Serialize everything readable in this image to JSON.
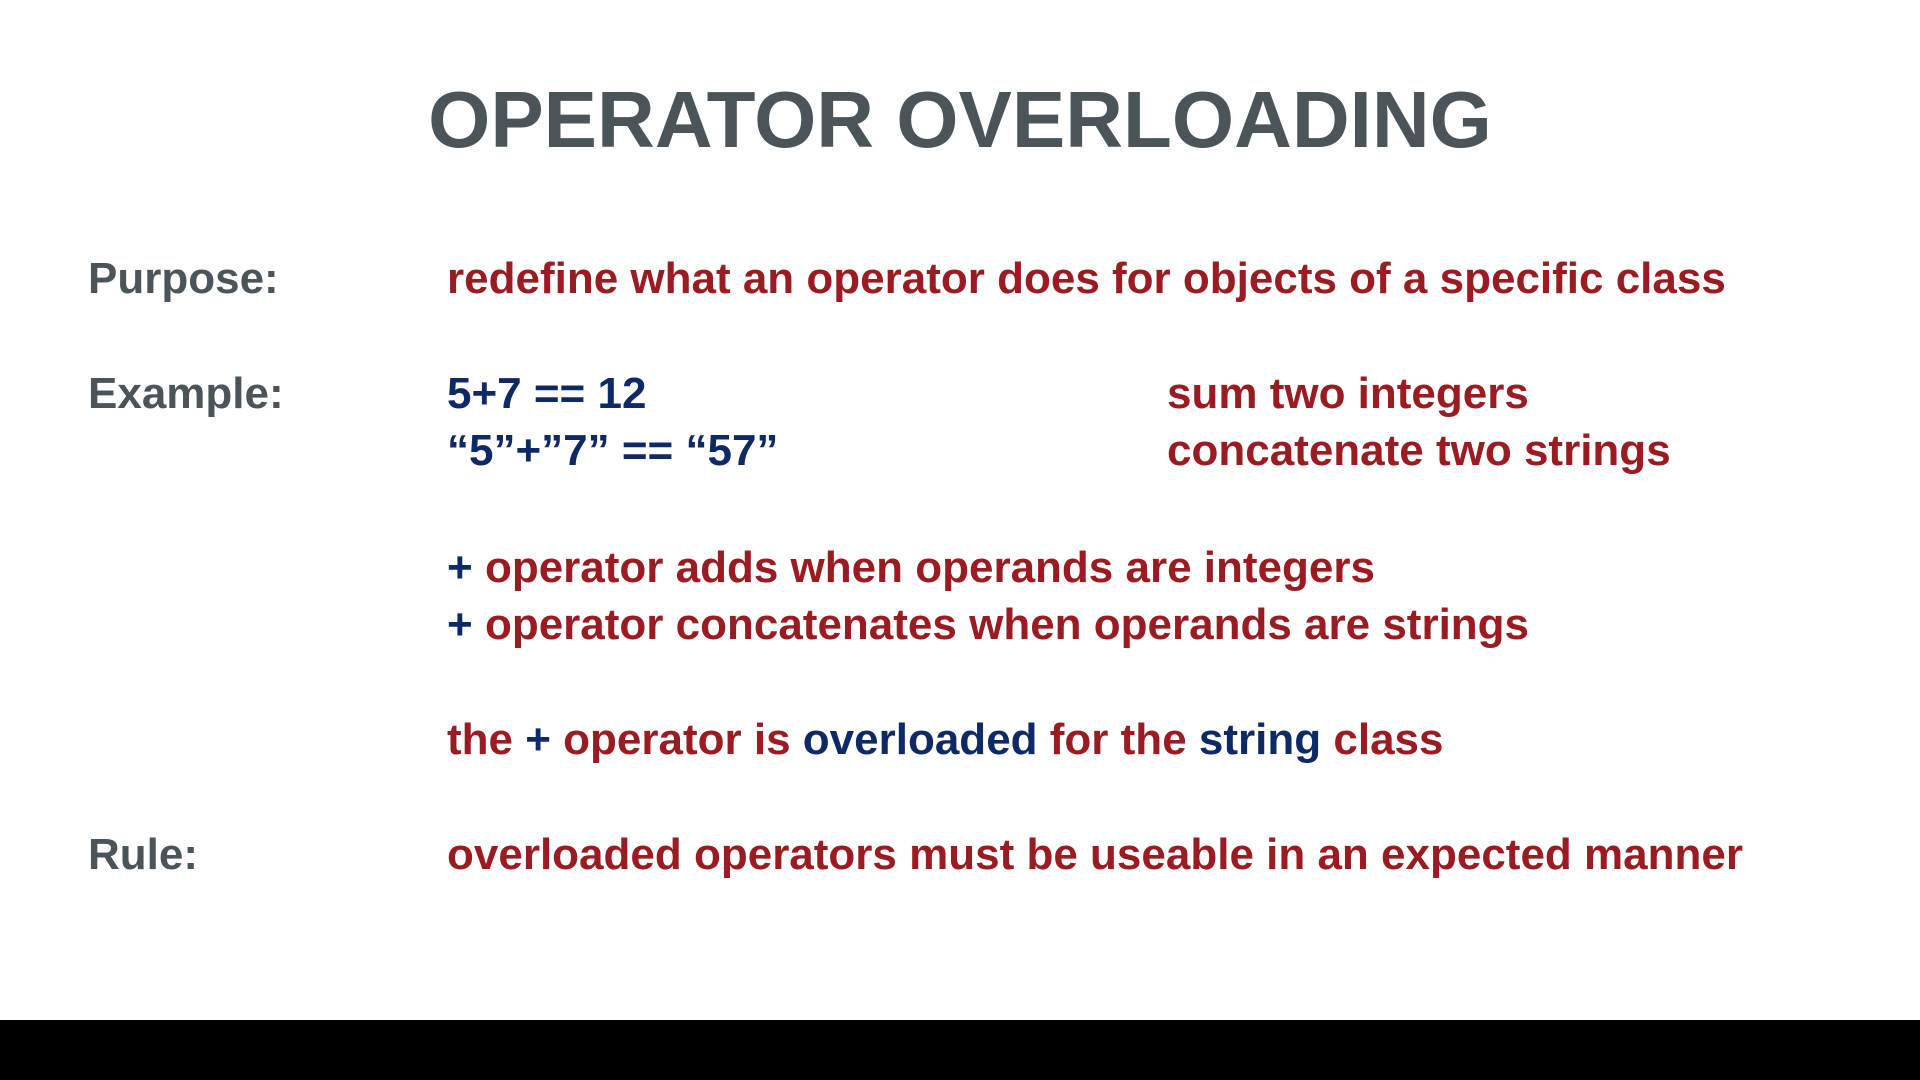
{
  "slide": {
    "title": "OPERATOR OVERLOADING",
    "purpose": {
      "label": "Purpose:",
      "text": "redefine what an operator does for objects of a specific class"
    },
    "example": {
      "label": "Example:",
      "rows": [
        {
          "code": "5+7 == 12",
          "desc": "sum two integers"
        },
        {
          "code": "“5”+”7” == “57”",
          "desc": "concatenate two strings"
        }
      ],
      "notes": [
        {
          "op": "+",
          "text": "operator adds when operands are integers"
        },
        {
          "op": "+",
          "text": "operator concatenates when operands are strings"
        }
      ],
      "conclusion": {
        "part1": "the",
        "op": "+",
        "part2": "operator is",
        "kw1": "overloaded",
        "part3": "for the",
        "kw2": "string",
        "part4": "class"
      }
    },
    "rule": {
      "label": "Rule:",
      "text": "overloaded operators must be useable in an expected manner"
    }
  },
  "colors": {
    "label": "#4b5559",
    "accent_red": "#9b1b22",
    "accent_blue": "#0d2a66",
    "bottom_bar": "#000000"
  }
}
